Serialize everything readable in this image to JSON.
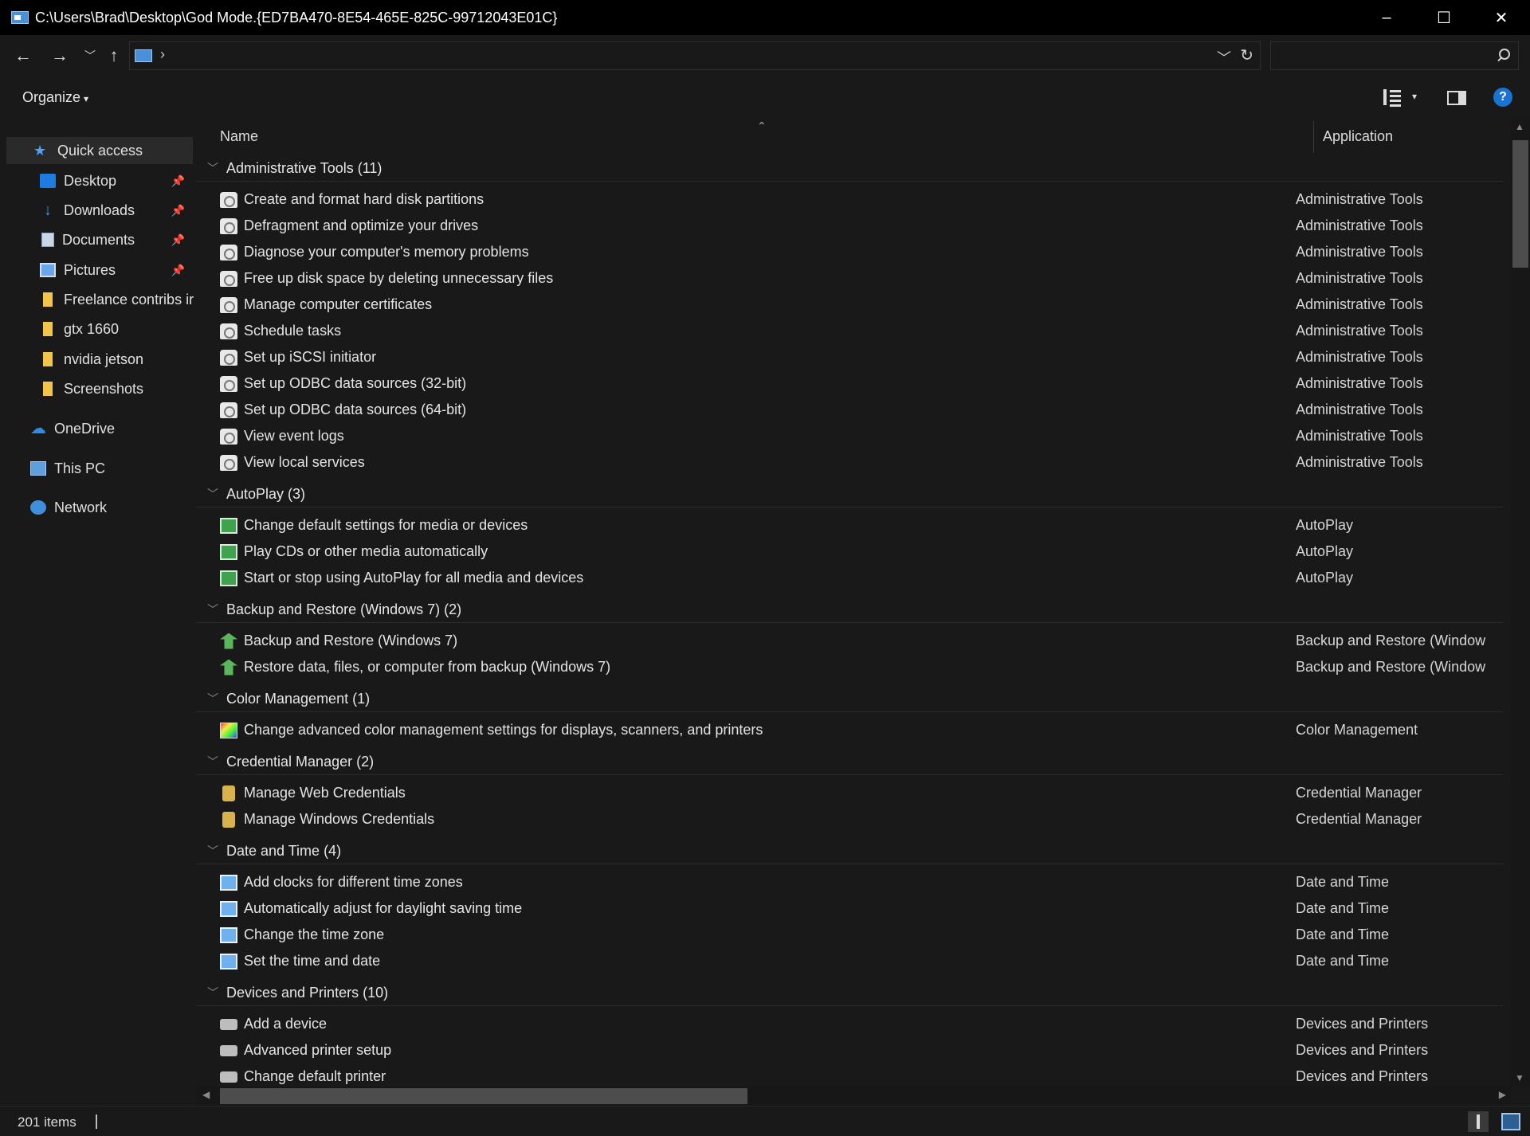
{
  "window": {
    "title": "C:\\Users\\Brad\\Desktop\\God Mode.{ED7BA470-8E54-465E-825C-99712043E01C}",
    "controls": [
      "–",
      "☐",
      "✕"
    ]
  },
  "toolbar": {
    "back": "←",
    "forward": "→",
    "recent": "﹀",
    "up": "↑",
    "address_chevron": "›",
    "address_dropdown": "﹀",
    "refresh": "↻",
    "search_placeholder": "",
    "organize_label": "Organize",
    "organize_caret": "▾",
    "view_caret": "▾",
    "help_label": "?"
  },
  "sidebar": {
    "items": [
      {
        "label": "Quick access",
        "icon": "star-icon",
        "pinned": false,
        "selected": true
      },
      {
        "label": "Desktop",
        "icon": "desktop-icon",
        "pinned": true
      },
      {
        "label": "Downloads",
        "icon": "download-icon",
        "pinned": true
      },
      {
        "label": "Documents",
        "icon": "documents-icon",
        "pinned": true
      },
      {
        "label": "Pictures",
        "icon": "pictures-icon",
        "pinned": true
      },
      {
        "label": "Freelance contribs ir",
        "icon": "folder-icon",
        "pinned": false
      },
      {
        "label": "gtx 1660",
        "icon": "folder-icon",
        "pinned": false
      },
      {
        "label": "nvidia jetson",
        "icon": "folder-icon",
        "pinned": false
      },
      {
        "label": "Screenshots",
        "icon": "folder-icon",
        "pinned": false
      },
      {
        "label": "OneDrive",
        "icon": "cloud-icon",
        "pinned": false
      },
      {
        "label": "This PC",
        "icon": "pc-icon",
        "pinned": false
      },
      {
        "label": "Network",
        "icon": "network-icon",
        "pinned": false
      }
    ],
    "pin_glyph": "📌"
  },
  "list": {
    "columns": {
      "name": "Name",
      "application": "Application"
    },
    "sort_caret": "⌃",
    "groups": [
      {
        "label": "Administrative Tools (11)",
        "icon": "admin-tools-icon",
        "rows": [
          {
            "name": "Create and format hard disk partitions",
            "app": "Administrative Tools"
          },
          {
            "name": "Defragment and optimize your drives",
            "app": "Administrative Tools"
          },
          {
            "name": "Diagnose your computer's memory problems",
            "app": "Administrative Tools"
          },
          {
            "name": "Free up disk space by deleting unnecessary files",
            "app": "Administrative Tools"
          },
          {
            "name": "Manage computer certificates",
            "app": "Administrative Tools"
          },
          {
            "name": "Schedule tasks",
            "app": "Administrative Tools"
          },
          {
            "name": "Set up iSCSI initiator",
            "app": "Administrative Tools"
          },
          {
            "name": "Set up ODBC data sources (32-bit)",
            "app": "Administrative Tools"
          },
          {
            "name": "Set up ODBC data sources (64-bit)",
            "app": "Administrative Tools"
          },
          {
            "name": "View event logs",
            "app": "Administrative Tools"
          },
          {
            "name": "View local services",
            "app": "Administrative Tools"
          }
        ]
      },
      {
        "label": "AutoPlay (3)",
        "icon": "autoplay-icon",
        "rows": [
          {
            "name": "Change default settings for media or devices",
            "app": "AutoPlay"
          },
          {
            "name": "Play CDs or other media automatically",
            "app": "AutoPlay"
          },
          {
            "name": "Start or stop using AutoPlay for all media and devices",
            "app": "AutoPlay"
          }
        ]
      },
      {
        "label": "Backup and Restore (Windows 7) (2)",
        "icon": "backup-icon",
        "rows": [
          {
            "name": "Backup and Restore (Windows 7)",
            "app": "Backup and Restore (Window"
          },
          {
            "name": "Restore data, files, or computer from backup (Windows 7)",
            "app": "Backup and Restore (Window"
          }
        ]
      },
      {
        "label": "Color Management (1)",
        "icon": "color-management-icon",
        "rows": [
          {
            "name": "Change advanced color management settings for displays, scanners, and printers",
            "app": "Color Management"
          }
        ]
      },
      {
        "label": "Credential Manager (2)",
        "icon": "credential-icon",
        "rows": [
          {
            "name": "Manage Web Credentials",
            "app": "Credential Manager"
          },
          {
            "name": "Manage Windows Credentials",
            "app": "Credential Manager"
          }
        ]
      },
      {
        "label": "Date and Time (4)",
        "icon": "date-time-icon",
        "rows": [
          {
            "name": "Add clocks for different time zones",
            "app": "Date and Time"
          },
          {
            "name": "Automatically adjust for daylight saving time",
            "app": "Date and Time"
          },
          {
            "name": "Change the time zone",
            "app": "Date and Time"
          },
          {
            "name": "Set the time and date",
            "app": "Date and Time"
          }
        ]
      },
      {
        "label": "Devices and Printers (10)",
        "icon": "printer-icon",
        "rows": [
          {
            "name": "Add a device",
            "app": "Devices and Printers"
          },
          {
            "name": "Advanced printer setup",
            "app": "Devices and Printers"
          },
          {
            "name": "Change default printer",
            "app": "Devices and Printers"
          }
        ]
      }
    ]
  },
  "status": {
    "items": "201 items"
  }
}
